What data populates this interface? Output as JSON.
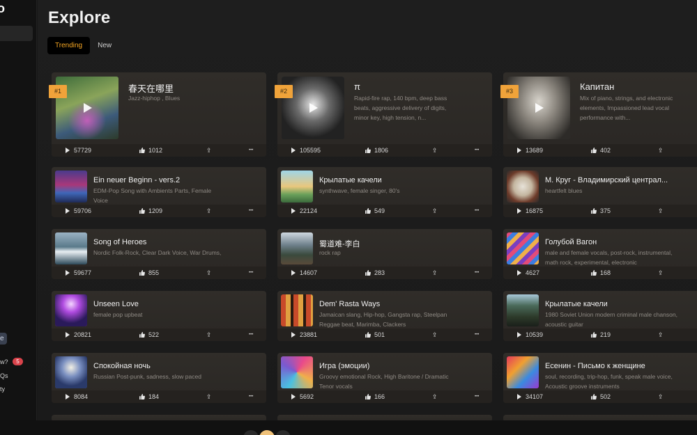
{
  "app": {
    "logo": "o"
  },
  "sidebar": {
    "pill_text": "e",
    "items": [
      {
        "label": "w?",
        "badge": "5"
      },
      {
        "label": "Qs"
      },
      {
        "label": "ty"
      }
    ]
  },
  "page": {
    "title": "Explore"
  },
  "tabs": [
    {
      "label": "Trending",
      "active": true
    },
    {
      "label": "New",
      "active": false
    }
  ],
  "top_songs": [
    {
      "rank": "#1",
      "title": "春天在哪里",
      "desc": "Jazz-hiphop , Blues",
      "plays": "57729",
      "likes": "1012",
      "art": "forest"
    },
    {
      "rank": "#2",
      "title": "π",
      "desc": "Rapid-fire rap, 140 bpm, deep bass beats, aggressive delivery of digits, minor key, high tension, n...",
      "plays": "105595",
      "likes": "1806",
      "art": "mech"
    },
    {
      "rank": "#3",
      "title": "Капитан",
      "desc": "Mix of piano, strings, and electronic elements, Impassioned lead vocal performance with...",
      "plays": "13689",
      "likes": "402",
      "art": "ship"
    }
  ],
  "songs": [
    {
      "title": "Ein neuer Beginn - vers.2",
      "desc": "EDM-Pop Song with Ambients Parts, Female Voice",
      "plays": "59706",
      "likes": "1209",
      "art": "city"
    },
    {
      "title": "Крылатые качели",
      "desc": "synthwave, female singer, 80's",
      "plays": "22124",
      "likes": "549",
      "art": "swing"
    },
    {
      "title": "М. Круг - Владимирский централ...",
      "desc": "heartfelt blues",
      "plays": "16875",
      "likes": "375",
      "art": "circle"
    },
    {
      "title": "Song of Heroes",
      "desc": "Nordic Folk-Rock, Clear Dark Voice, War Drums,",
      "plays": "59677",
      "likes": "855",
      "art": "sea"
    },
    {
      "title": "蜀道难-李白",
      "desc": "rock rap",
      "plays": "14607",
      "likes": "283",
      "art": "mountain"
    },
    {
      "title": "Голубой Вагон",
      "desc": "male and female vocals, post-rock, instrumental, math rock, experimental, electronic",
      "plays": "4627",
      "likes": "168",
      "art": "waves"
    },
    {
      "title": "Unseen Love",
      "desc": "female pop upbeat",
      "plays": "20821",
      "likes": "522",
      "art": "neon"
    },
    {
      "title": "Dem' Rasta Ways",
      "desc": "Jamaican slang, Hip-hop, Gangsta rap, Steelpan Reggae beat, Marimba, Clackers",
      "plays": "23881",
      "likes": "501",
      "art": "pattern"
    },
    {
      "title": "Крылатые качели",
      "desc": "1980 Soviet Union modern criminal male chanson, acoustic guitar",
      "plays": "10539",
      "likes": "219",
      "art": "woods"
    },
    {
      "title": "Спокойная ночь",
      "desc": "Russian Post-punk, sadness, slow paced",
      "plays": "8084",
      "likes": "184",
      "art": "night"
    },
    {
      "title": "Игра (эмоции)",
      "desc": "Groovy emotional Rock, High Baritone / Dramatic Tenor vocals",
      "plays": "5692",
      "likes": "166",
      "art": "swirl"
    },
    {
      "title": "Есенин - Письмо к женщине",
      "desc": "soul, recording, trip-hop, funk, speak male voice, Acoustic groove instruments",
      "plays": "34107",
      "likes": "502",
      "art": "faces"
    }
  ],
  "icons": {
    "play": "play-icon",
    "like": "thumbs-up-icon",
    "share": "share-icon",
    "more": "more-icon"
  },
  "colors": {
    "accent": "#f5a623",
    "rank_badge": "#f0a33a",
    "badge_red": "#d9434b",
    "card": "#2e2b27"
  }
}
